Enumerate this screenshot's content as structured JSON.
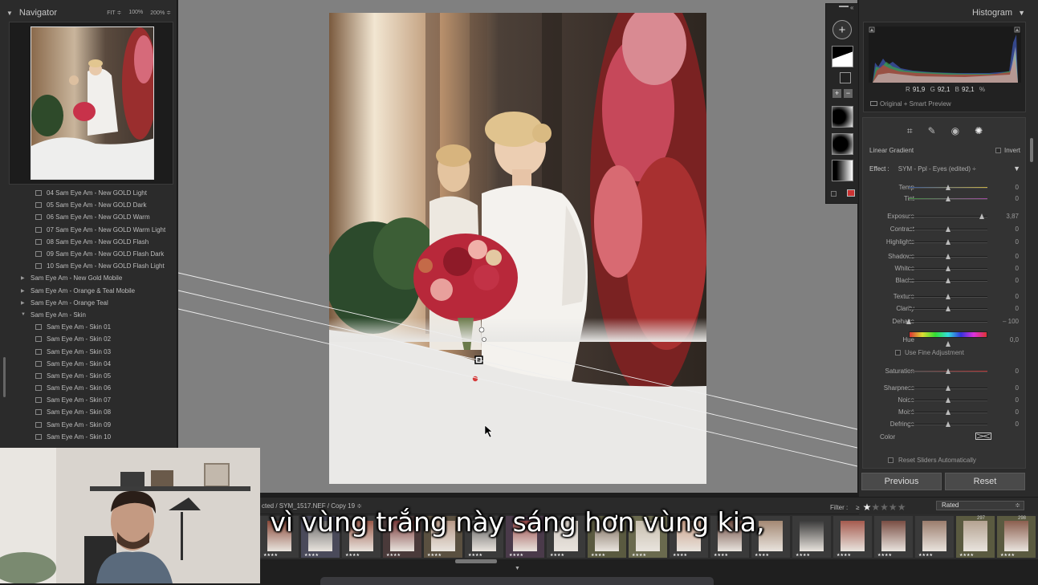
{
  "navigator": {
    "title": "Navigator",
    "zoom_fit": "FIT ≑",
    "zoom_100": "100%",
    "zoom_200": "200% ≑"
  },
  "presets": [
    {
      "label": "04 Sam Eye Am - New GOLD Light",
      "type": "preset"
    },
    {
      "label": "05 Sam Eye Am - New GOLD Dark",
      "type": "preset"
    },
    {
      "label": "06 Sam Eye Am - New GOLD Warm",
      "type": "preset"
    },
    {
      "label": "07 Sam Eye Am - New GOLD Warm Light",
      "type": "preset"
    },
    {
      "label": "08 Sam Eye Am - New GOLD Flash",
      "type": "preset"
    },
    {
      "label": "09 Sam Eye Am - New GOLD Flash Dark",
      "type": "preset"
    },
    {
      "label": "10 Sam Eye Am - New GOLD Flash Light",
      "type": "preset"
    },
    {
      "label": "Sam Eye Am - New Gold Mobile",
      "type": "group"
    },
    {
      "label": "Sam Eye Am - Orange & Teal Mobile",
      "type": "group"
    },
    {
      "label": "Sam Eye Am - Orange Teal",
      "type": "group"
    },
    {
      "label": "Sam Eye Am - Skin",
      "type": "group-open"
    },
    {
      "label": "Sam Eye Am - Skin 01",
      "type": "preset"
    },
    {
      "label": "Sam Eye Am - Skin 02",
      "type": "preset"
    },
    {
      "label": "Sam Eye Am - Skin 03",
      "type": "preset"
    },
    {
      "label": "Sam Eye Am - Skin 04",
      "type": "preset"
    },
    {
      "label": "Sam Eye Am - Skin 05",
      "type": "preset"
    },
    {
      "label": "Sam Eye Am - Skin 06",
      "type": "preset"
    },
    {
      "label": "Sam Eye Am - Skin 07",
      "type": "preset"
    },
    {
      "label": "Sam Eye Am - Skin 08",
      "type": "preset"
    },
    {
      "label": "Sam Eye Am - Skin 09",
      "type": "preset"
    },
    {
      "label": "Sam Eye Am - Skin 10",
      "type": "preset"
    }
  ],
  "histogram": {
    "title": "Histogram",
    "r_label": "R",
    "r_value": "91,9",
    "g_label": "G",
    "g_value": "92,1",
    "b_label": "B",
    "b_value": "92,1",
    "unit": "%",
    "preview_mode": "Original + Smart Preview"
  },
  "mask": {
    "mask_type": "Linear Gradient",
    "invert_label": "Invert",
    "effect_label": "Effect :",
    "effect_value": "SYM - Ppl - Eyes (edited) ÷",
    "fine_adjustment": "Use Fine Adjustment",
    "color_label": "Color",
    "reset_auto": "Reset Sliders Automatically",
    "sliders": [
      {
        "name": "Temp",
        "value": "0",
        "pos": 0.5
      },
      {
        "name": "Tint",
        "value": "0",
        "pos": 0.5
      },
      {
        "name": "Exposure",
        "value": "3,87",
        "pos": 0.93
      },
      {
        "name": "Contrast",
        "value": "0",
        "pos": 0.5
      },
      {
        "name": "Highlights",
        "value": "0",
        "pos": 0.5
      },
      {
        "name": "Shadows",
        "value": "0",
        "pos": 0.5
      },
      {
        "name": "Whites",
        "value": "0",
        "pos": 0.5
      },
      {
        "name": "Blacks",
        "value": "0",
        "pos": 0.5
      },
      {
        "name": "Texture",
        "value": "0",
        "pos": 0.5
      },
      {
        "name": "Clarity",
        "value": "0",
        "pos": 0.5
      },
      {
        "name": "Dehaze",
        "value": "– 100",
        "pos": 0.0
      },
      {
        "name": "Hue",
        "value": "0,0",
        "pos": 0.5
      },
      {
        "name": "Saturation",
        "value": "0",
        "pos": 0.5
      },
      {
        "name": "Sharpness",
        "value": "0",
        "pos": 0.5
      },
      {
        "name": "Noise",
        "value": "0",
        "pos": 0.5
      },
      {
        "name": "Moiré",
        "value": "0",
        "pos": 0.5
      },
      {
        "name": "Defringe",
        "value": "0",
        "pos": 0.5
      }
    ]
  },
  "buttons": {
    "previous": "Previous",
    "reset": "Reset"
  },
  "filmstrip": {
    "path": "cted / SYM_1517.NEF / Copy 19 ≑",
    "filter_label": "Filter :",
    "filter_op": "≥",
    "stars_on": 1,
    "rated": "Rated",
    "thumb_numbers": [
      "297",
      "298"
    ],
    "stars_text": "★★★★"
  },
  "subtitle": "vì vùng trắng này sáng hơn vùng kia,"
}
